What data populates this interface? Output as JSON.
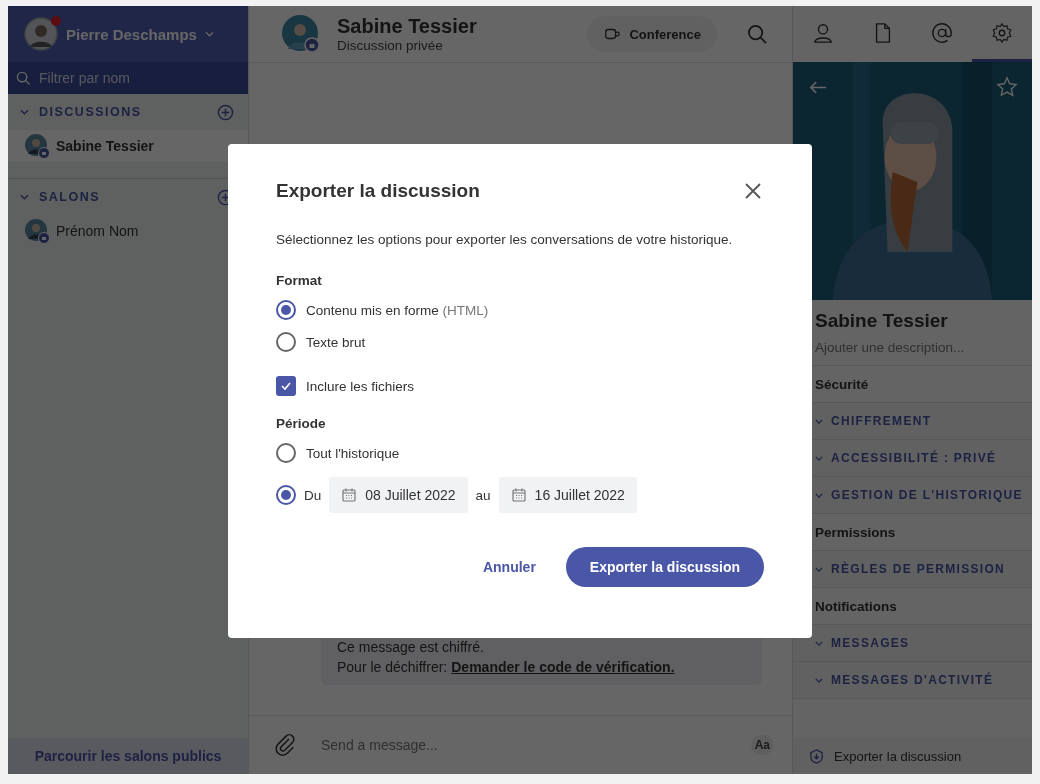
{
  "user": {
    "name": "Pierre Deschamps",
    "notification": true
  },
  "sidebar": {
    "search_placeholder": "Filtrer par nom",
    "sections": [
      {
        "title": "DISCUSSIONS",
        "items": [
          {
            "name": "Sabine Tessier",
            "selected": true
          }
        ]
      },
      {
        "title": "SALONS",
        "items": [
          {
            "name": "Prénom Nom",
            "selected": false
          }
        ]
      }
    ],
    "footer_link": "Parcourir les salons publics"
  },
  "chat": {
    "title": "Sabine Tessier",
    "subtitle": "Discussion privée",
    "conference_button": "Conference",
    "message": {
      "line_1": "Ce message est chiffré.",
      "line_2": "Pour le déchiffrer:",
      "link": "Demander le code de vérification."
    },
    "composer_placeholder": "Send a message...",
    "format_button": "Aa"
  },
  "right_panel": {
    "tabs": [
      {
        "kind": "person",
        "selected": false
      },
      {
        "kind": "file",
        "selected": false
      },
      {
        "kind": "mention",
        "selected": false
      },
      {
        "kind": "settings",
        "selected": true
      }
    ],
    "name": "Sabine Tessier",
    "description_placeholder": "Ajouter une description...",
    "sections": [
      {
        "title": "Sécurité",
        "items": [
          "CHIFFREMENT",
          "ACCESSIBILITÉ : PRIVÉ",
          "GESTION DE L'HISTORIQUE"
        ]
      },
      {
        "title": "Permissions",
        "items": [
          "RÈGLES DE PERMISSION"
        ]
      },
      {
        "title": "Notifications",
        "items": [
          "MESSAGES",
          "MESSAGES D'ACTIVITÉ"
        ]
      }
    ],
    "export_link": "Exporter la discussion"
  },
  "dialog": {
    "title": "Exporter la discussion",
    "description": "Sélectionnez les options pour exporter les conversations de votre historique.",
    "format_label": "Format",
    "format_options": [
      {
        "label": "Contenu mis en forme",
        "hint": "(HTML)",
        "selected": true
      },
      {
        "label": "Texte brut",
        "selected": false
      }
    ],
    "include_files": {
      "label": "Inclure les fichiers",
      "checked": true
    },
    "period_label": "Période",
    "period_options": [
      {
        "kind": "all",
        "label": "Tout l'historique",
        "selected": false
      },
      {
        "kind": "range",
        "label": "Du",
        "from": "08 Juillet 2022",
        "between": "au",
        "to": "16 Juillet 2022",
        "selected": true
      }
    ],
    "cancel_button": "Annuler",
    "confirm_button": "Exporter la discussion"
  }
}
